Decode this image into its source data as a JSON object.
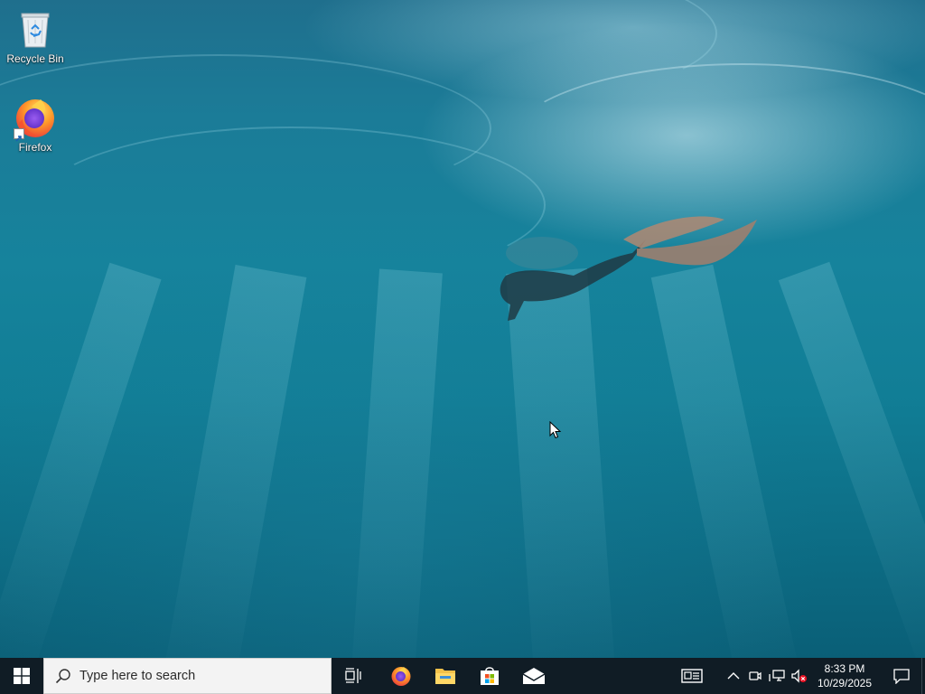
{
  "desktop": {
    "icons": [
      {
        "label": "Recycle Bin",
        "icon": "recycle-bin-icon"
      },
      {
        "label": "Firefox",
        "icon": "firefox-icon"
      }
    ]
  },
  "taskbar": {
    "search": {
      "placeholder": "Type here to search",
      "icon": "search-icon"
    },
    "apps": [
      {
        "name": "Task View",
        "icon": "task-view-icon"
      },
      {
        "name": "Firefox",
        "icon": "firefox-icon"
      },
      {
        "name": "File Explorer",
        "icon": "folder-icon"
      },
      {
        "name": "Microsoft Store",
        "icon": "store-icon"
      },
      {
        "name": "Mail",
        "icon": "mail-icon"
      }
    ],
    "tray": {
      "time": "8:33 PM",
      "date": "10/29/2025",
      "icons": [
        "news-icon",
        "chevron-up-icon",
        "meet-now-icon",
        "network-icon",
        "volume-muted-icon",
        "notification-icon"
      ]
    }
  },
  "colors": {
    "taskbar_bg": "#101c25",
    "search_bg": "#f3f3f3",
    "windows_blue": "#ffffff"
  }
}
